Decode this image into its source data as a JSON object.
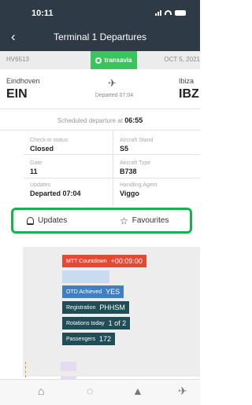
{
  "status": {
    "time": "10:11"
  },
  "nav": {
    "back_icon": "chevron-left-icon",
    "title": "Terminal 1 Departures"
  },
  "flight": {
    "number": "HV6513",
    "brand": "transavia",
    "date": "OCT 5, 2021"
  },
  "route": {
    "origin_city": "Eindhoven",
    "origin_code": "EIN",
    "dest_city": "Ibiza",
    "dest_code": "IBZ",
    "status_text": "Departed 07:04"
  },
  "scheduled": {
    "label": "Scheduled departure at",
    "time": "06:55"
  },
  "details": {
    "checkin_label": "Check-in status",
    "checkin_value": "Closed",
    "stand_label": "Aircraft Stand",
    "stand_value": "S5",
    "gate_label": "Gate",
    "gate_value": "11",
    "type_label": "Aircraft Type",
    "type_value": "B738",
    "updates_label": "Updates",
    "updates_value": "Departed 07:04",
    "agent_label": "Handling Agent",
    "agent_value": "Viggo"
  },
  "actions": {
    "updates": "Updates",
    "favourites": "Favourites"
  },
  "timeline": {
    "mtt_label": "MTT Countdown",
    "mtt_value": "+00:09:00",
    "otd_label": "OTD Achieved",
    "otd_value": "YES",
    "reg_label": "Registration",
    "reg_value": "PHHSM",
    "rot_label": "Rotations today",
    "rot_value": "1 of 2",
    "pax_label": "Passengers",
    "pax_value": "172"
  },
  "colors": {
    "header": "#2e3a46",
    "brand_green": "#3cc45c",
    "highlight": "#17b24a",
    "countdown": "#e24a33",
    "otd": "#3f7fc4",
    "info_tag": "#1f4e57"
  },
  "tabbar": [
    "home-icon",
    "chat-icon",
    "bell-icon",
    "plane-icon"
  ]
}
